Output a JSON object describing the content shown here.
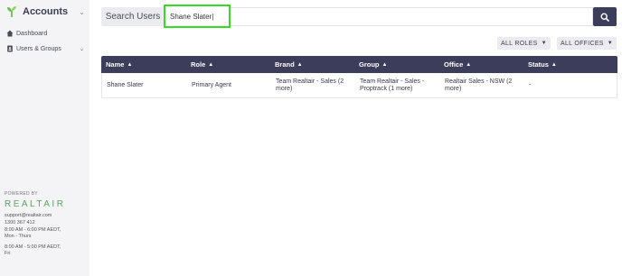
{
  "sidebar": {
    "title": "Accounts",
    "nav": [
      {
        "label": "Dashboard"
      },
      {
        "label": "Users & Groups"
      }
    ],
    "powered_by": "POWERED BY",
    "logo_text": "REALTAIR",
    "support": {
      "email": "support@realtair.com",
      "phone": "1300 367 412",
      "hours1": "8:00 AM - 6:00 PM AEDT,",
      "days1": "Mon - Thurs",
      "hours2": "8:00 AM - 5:00 PM AEDT,",
      "days2": "Fri"
    }
  },
  "search": {
    "label": "Search Users",
    "value": "Shane Slater|"
  },
  "filters": {
    "roles": "ALL ROLES",
    "offices": "ALL OFFICES"
  },
  "table": {
    "columns": [
      "Name",
      "Role",
      "Brand",
      "Group",
      "Office",
      "Status"
    ],
    "rows": [
      {
        "name": "Shane Slater",
        "role": "Primary Agent",
        "brand_line1": "Team Realtair - Sales (2",
        "brand_line2": "more)",
        "group_line1": "Team Realtair - Sales -",
        "group_line2": "Proptrack (1 more)",
        "office_line1": "Realtair Sales - NSW (2",
        "office_line2": "more)",
        "status": "-"
      }
    ]
  },
  "colors": {
    "header_bg": "#3c3d5b",
    "highlight": "#33dd22",
    "logo_green": "#5aa45a"
  }
}
